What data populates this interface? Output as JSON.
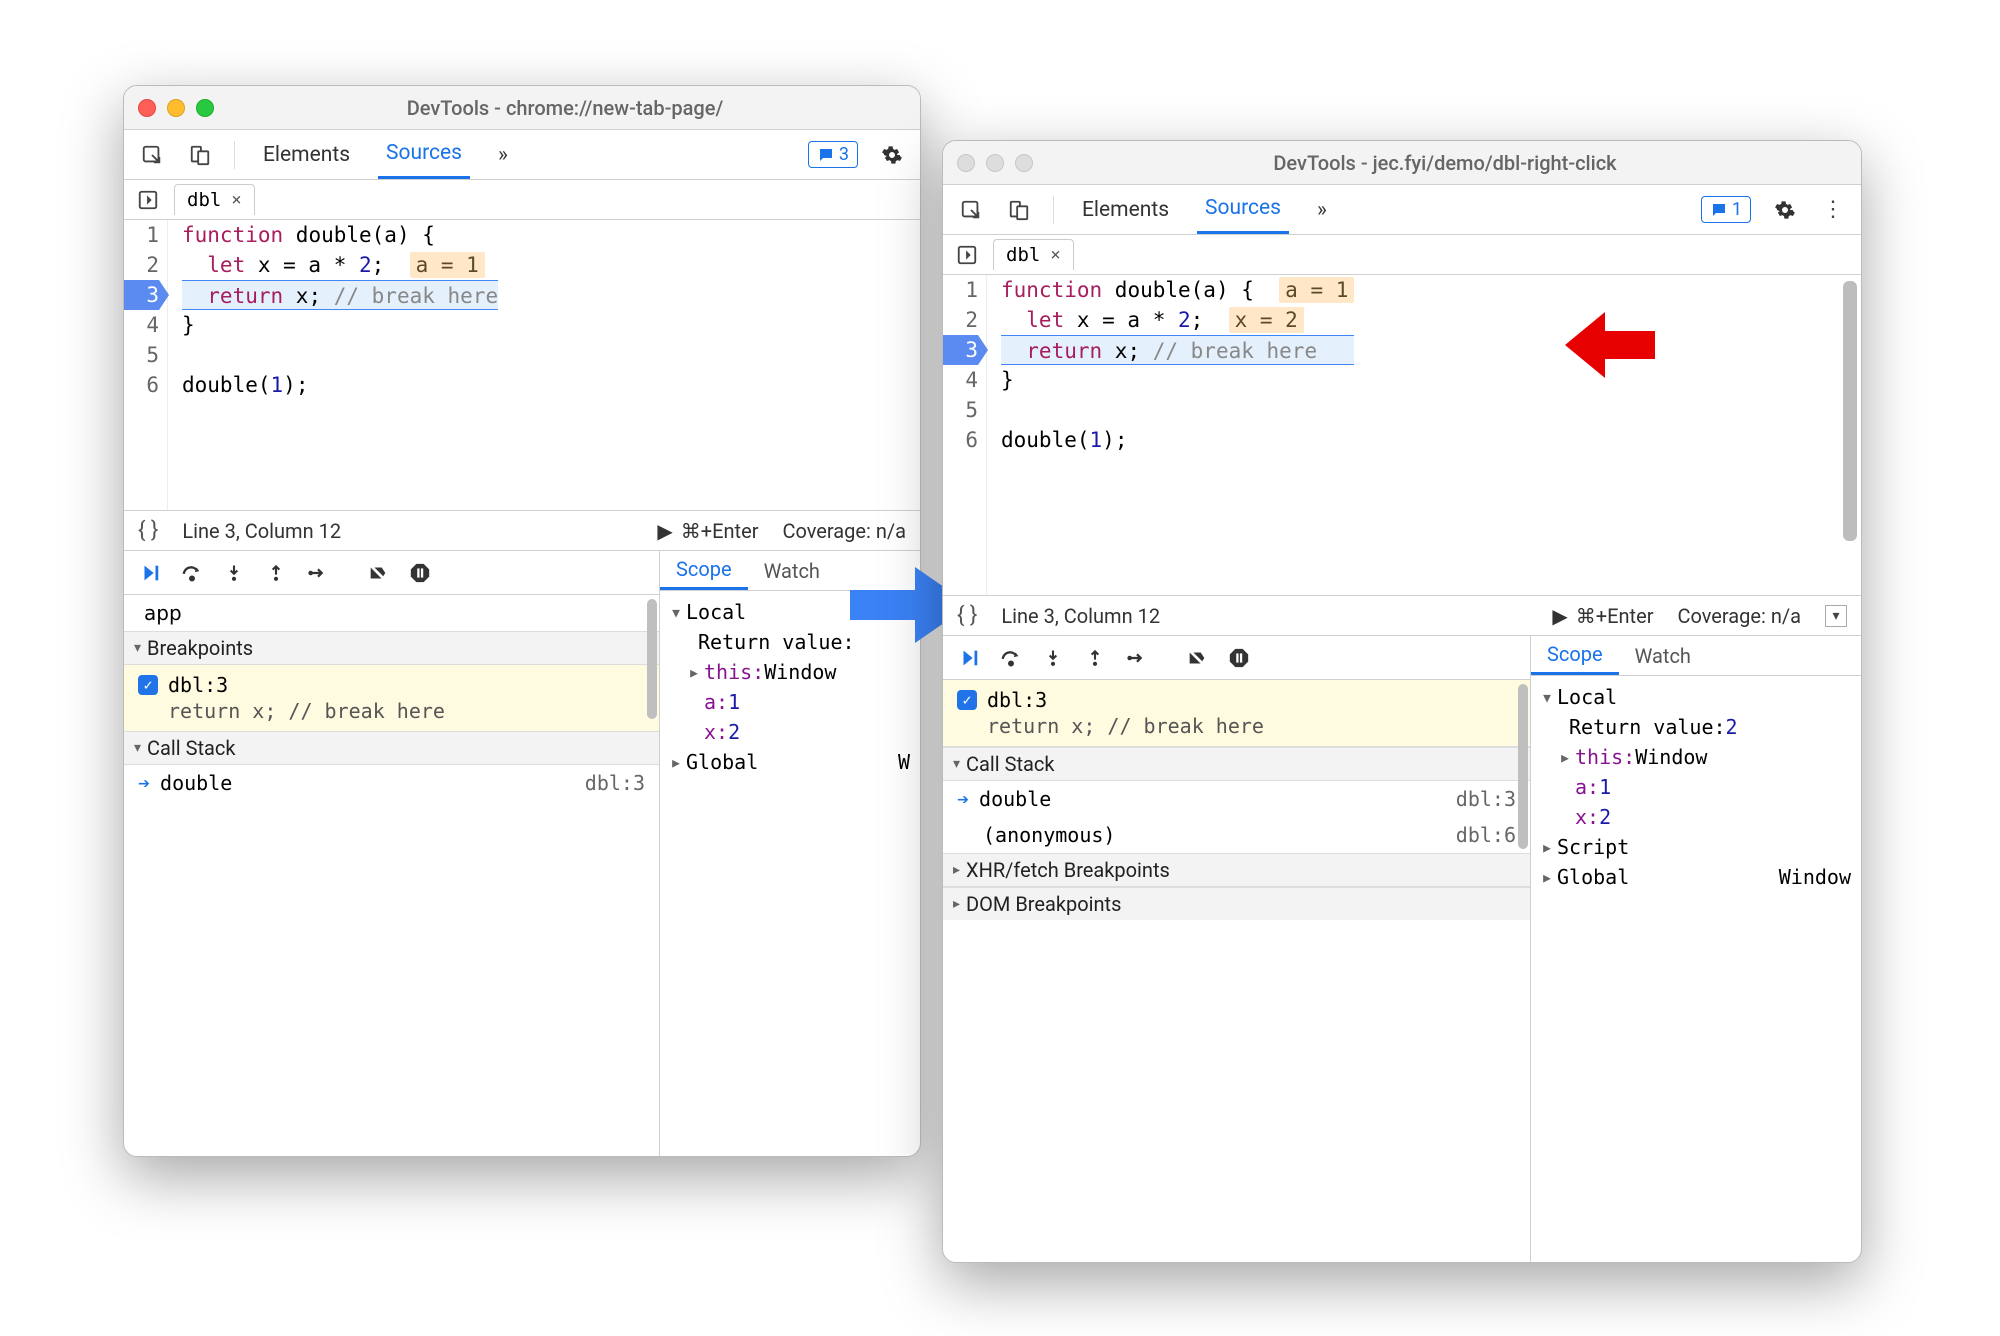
{
  "window1": {
    "title": "DevTools - chrome://new-tab-page/",
    "tabs": {
      "elements": "Elements",
      "sources": "Sources",
      "more": "»"
    },
    "issues_count": "3",
    "file": {
      "name": "dbl",
      "close": "×"
    },
    "code": {
      "l1a": "function",
      "l1b": " double(a) {",
      "l2a": "  let",
      "l2b": " x = a * ",
      "l2c": "2",
      "l2d": ";  ",
      "l2hint": "a = 1",
      "l3a": "  return",
      "l3b": " x; ",
      "l3c": "// break here",
      "l4": "}",
      "l5": " ",
      "l6a": "double(",
      "l6b": "1",
      "l6c": ");"
    },
    "status": {
      "pos": "Line 3, Column 12",
      "hint": "⌘+Enter",
      "coverage": "Coverage: n/a"
    },
    "panel": {
      "app": "app",
      "breakpoints": "Breakpoints",
      "bp_label": "dbl:3",
      "bp_text": "return x; // break here",
      "callstack": "Call Stack",
      "frame": "double",
      "frame_loc": "dbl:3"
    },
    "scope": {
      "tab_scope": "Scope",
      "tab_watch": "Watch",
      "local": "Local",
      "retval": "Return value:",
      "this_k": "this:",
      "this_v": "Window",
      "a_k": "a:",
      "a_v": "1",
      "x_k": "x:",
      "x_v": "2",
      "global": "Global",
      "global_v": "W"
    }
  },
  "window2": {
    "title": "DevTools - jec.fyi/demo/dbl-right-click",
    "tabs": {
      "elements": "Elements",
      "sources": "Sources",
      "more": "»"
    },
    "issues_count": "1",
    "file": {
      "name": "dbl",
      "close": "×"
    },
    "code": {
      "l1a": "function",
      "l1b": " double(a) {  ",
      "l1hint": "a = 1",
      "l2a": "  let",
      "l2b": " x = a * ",
      "l2c": "2",
      "l2d": ";  ",
      "l2hint": "x = 2",
      "l3a": "  return",
      "l3b": " x; ",
      "l3c": "// break here",
      "l4": "}",
      "l5": " ",
      "l6a": "double(",
      "l6b": "1",
      "l6c": ");"
    },
    "status": {
      "pos": "Line 3, Column 12",
      "hint": "⌘+Enter",
      "coverage": "Coverage: n/a"
    },
    "panel": {
      "bp_label": "dbl:3",
      "bp_text": "return x; // break here",
      "callstack": "Call Stack",
      "frame1": "double",
      "frame1_loc": "dbl:3",
      "frame2": "(anonymous)",
      "frame2_loc": "dbl:6",
      "xhr": "XHR/fetch Breakpoints",
      "dom": "DOM Breakpoints"
    },
    "scope": {
      "tab_scope": "Scope",
      "tab_watch": "Watch",
      "local": "Local",
      "retval_k": "Return value:",
      "retval_v": "2",
      "this_k": "this:",
      "this_v": "Window",
      "a_k": "a:",
      "a_v": "1",
      "x_k": "x:",
      "x_v": "2",
      "script": "Script",
      "global": "Global",
      "global_v": "Window"
    }
  }
}
